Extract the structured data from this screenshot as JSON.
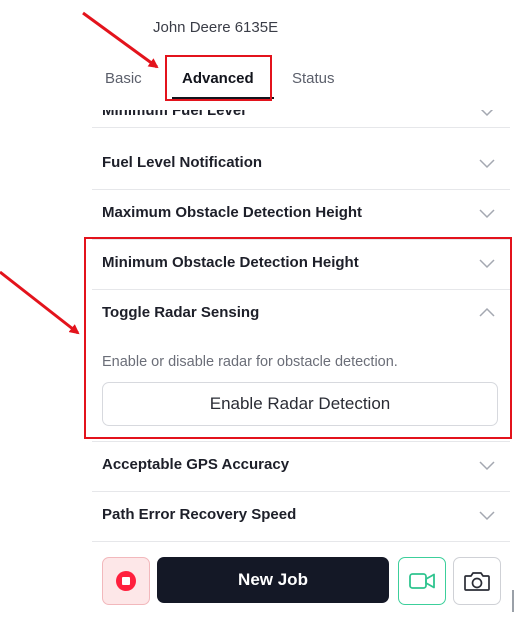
{
  "header": {
    "device_name": "John Deere 6135E"
  },
  "tabs": [
    {
      "label": "Basic",
      "active": false
    },
    {
      "label": "Advanced",
      "active": true
    },
    {
      "label": "Status",
      "active": false
    }
  ],
  "settings": [
    {
      "label": "Minimum Fuel Level",
      "expanded": false
    },
    {
      "label": "Fuel Level Notification",
      "expanded": false
    },
    {
      "label": "Maximum Obstacle Detection Height",
      "expanded": false
    },
    {
      "label": "Minimum Obstacle Detection Height",
      "expanded": false
    },
    {
      "label": "Toggle Radar Sensing",
      "expanded": true
    },
    {
      "label": "Acceptable GPS Accuracy",
      "expanded": false
    },
    {
      "label": "Path Error Recovery Speed",
      "expanded": false
    }
  ],
  "radar": {
    "description": "Enable or disable radar for obstacle detection.",
    "button_label": "Enable Radar Detection"
  },
  "bottom_bar": {
    "new_job_label": "New Job",
    "stop_icon": "stop-icon",
    "video_icon": "video-camera-icon",
    "camera_icon": "camera-icon"
  },
  "colors": {
    "annotation": "#e3131c",
    "primary_dark": "#141826",
    "stop_red": "#ff1f3d",
    "video_green": "#3ccf9b"
  }
}
